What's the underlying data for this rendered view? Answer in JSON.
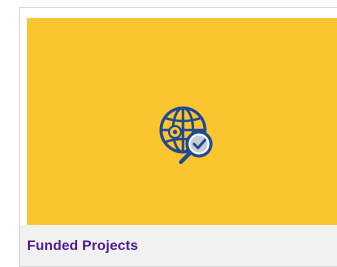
{
  "card": {
    "title": "Funded Projects",
    "icon": "globe-magnifier-checkmark-icon",
    "colors": {
      "banner": "#fbc52f",
      "title": "#4b1b8f",
      "icon_stroke": "#1f4a92",
      "footer_bg": "#f1f1f1"
    }
  }
}
